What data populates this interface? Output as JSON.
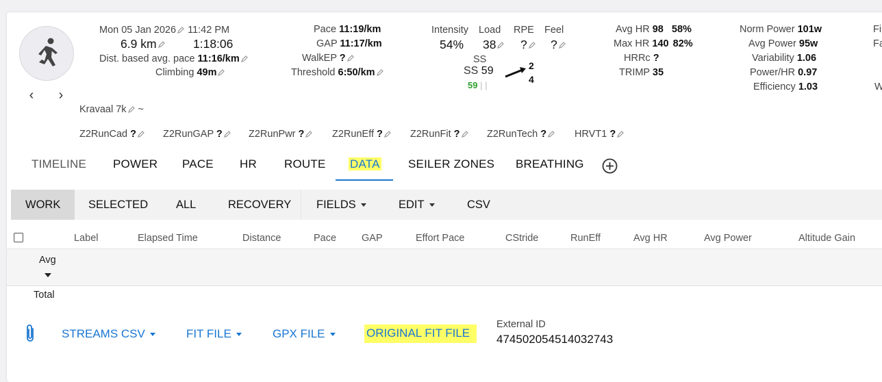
{
  "header": {
    "date_time": "Mon 05 Jan 2026",
    "time": "11:42 PM",
    "distance": "6.9 km",
    "duration": "1:18:06",
    "dist_pace_label": "Dist. based avg. pace",
    "dist_pace_value": "11:16/km",
    "climbing_label": "Climbing",
    "climbing_value": "49m",
    "name": "Kravaal 7k",
    "tilde": "~"
  },
  "stats_pace": {
    "pace_label": "Pace",
    "pace_value": "11:19/km",
    "gap_label": "GAP",
    "gap_value": "11:17/km",
    "walkep_label": "WalkEP",
    "walkep_value": "?",
    "threshold_label": "Threshold",
    "threshold_value": "6:50/km"
  },
  "stats_load": {
    "intensity_label": "Intensity",
    "intensity_value": "54%",
    "load_label": "Load",
    "load_value": "38",
    "rpe_label": "RPE",
    "rpe_value": "?",
    "feel_label": "Feel",
    "feel_value": "?",
    "ss_label": "SS",
    "ss_text": "SS",
    "ss_value": "59",
    "ss_sub": "59",
    "arrow_top": "2",
    "arrow_bottom": "4"
  },
  "stats_hr": {
    "avg_hr_label": "Avg HR",
    "avg_hr_value": "98",
    "avg_hr_pct": "58%",
    "max_hr_label": "Max HR",
    "max_hr_value": "140",
    "max_hr_pct": "82%",
    "hrrc_label": "HRRc",
    "hrrc_value": "?",
    "trimp_label": "TRIMP",
    "trimp_value": "35"
  },
  "stats_power": {
    "norm_power_label": "Norm Power",
    "norm_power_value": "101w",
    "avg_power_label": "Avg Power",
    "avg_power_value": "95w",
    "variability_label": "Variability",
    "variability_value": "1.06",
    "power_hr_label": "Power/HR",
    "power_hr_value": "0.97",
    "efficiency_label": "Efficiency",
    "efficiency_value": "1.03",
    "cut_1": "Fi",
    "cut_2": "Fa",
    "cut_3": "W"
  },
  "custom_fields": [
    {
      "label": "Z2RunCad",
      "value": "?"
    },
    {
      "label": "Z2RunGAP",
      "value": "?"
    },
    {
      "label": "Z2RunPwr",
      "value": "?"
    },
    {
      "label": "Z2RunEff",
      "value": "?"
    },
    {
      "label": "Z2RunFit",
      "value": "?"
    },
    {
      "label": "Z2RunTech",
      "value": "?"
    },
    {
      "label": "HRVT1",
      "value": "?"
    }
  ],
  "tabs": [
    "TIMELINE",
    "POWER",
    "PACE",
    "HR",
    "ROUTE",
    "DATA",
    "SEILER ZONES",
    "BREATHING"
  ],
  "active_tab": "DATA",
  "toolbar": {
    "work": "WORK",
    "selected": "SELECTED",
    "all": "ALL",
    "recovery": "RECOVERY",
    "fields": "FIELDS",
    "edit": "EDIT",
    "csv": "CSV"
  },
  "table": {
    "columns": [
      "Label",
      "Elapsed Time",
      "Distance",
      "Pace",
      "GAP",
      "Effort Pace",
      "CStride",
      "RunEff",
      "Avg HR",
      "Avg Power",
      "Altitude Gain"
    ],
    "avg_label": "Avg",
    "total_label": "Total"
  },
  "downloads": {
    "streams_csv": "STREAMS CSV",
    "fit_file": "FIT FILE",
    "gpx_file": "GPX FILE",
    "original_fit": "ORIGINAL FIT FILE",
    "external_id_label": "External ID",
    "external_id_value": "474502054514032743"
  },
  "colors": {
    "accent": "#1976d2",
    "highlight": "#ffff66",
    "ss_green": "#2e9e2e"
  },
  "icons": {
    "avatar": "running-person-icon",
    "prev": "chevron-left-icon",
    "next": "chevron-right-icon",
    "add_tab": "plus-circle-icon",
    "attach": "paperclip-icon",
    "edit": "pencil-icon"
  }
}
